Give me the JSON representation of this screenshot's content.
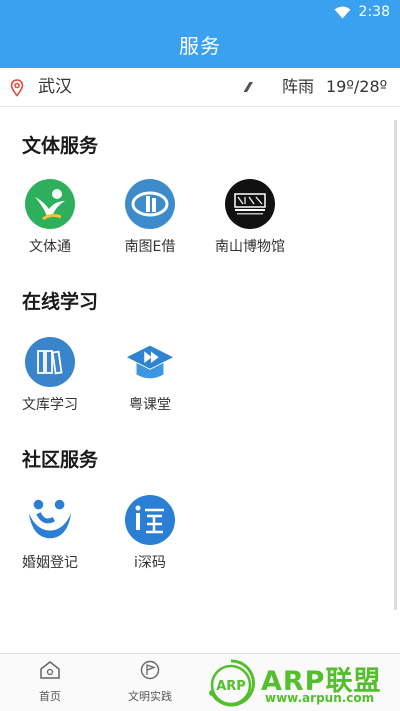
{
  "status_bar": {
    "time": "2:38",
    "wifi_icon": "wifi-icon",
    "battery_icon": "battery-icon"
  },
  "header": {
    "title": "服务",
    "background": "#3aa0f0"
  },
  "info_bar": {
    "location_icon": "location-pin-icon",
    "city": "武汉",
    "weather_icon": "rain-icon",
    "weather": "阵雨",
    "temperature": "19º/28º"
  },
  "sections": [
    {
      "title": "文体服务",
      "items": [
        {
          "label": "文体通",
          "icon": "wentitong-logo-icon",
          "color": "#2eaf5c"
        },
        {
          "label": "南图E借",
          "icon": "nantu-logo-icon",
          "color": "#3c8ccc"
        },
        {
          "label": "南山博物馆",
          "icon": "nanshan-museum-logo-icon",
          "color": "#111111"
        }
      ]
    },
    {
      "title": "在线学习",
      "items": [
        {
          "label": "文库学习",
          "icon": "books-icon",
          "color": "#3a84cc"
        },
        {
          "label": "粤课堂",
          "icon": "graduation-cap-play-icon",
          "color": "#2e84d0"
        }
      ]
    },
    {
      "title": "社区服务",
      "items": [
        {
          "label": "婚姻登记",
          "icon": "marriage-logo-icon",
          "color": "#2a7fd4"
        },
        {
          "label": "i深码",
          "icon": "ishen-logo-icon",
          "color": "#2a7fd4"
        }
      ]
    }
  ],
  "tabs": [
    {
      "label": "首页",
      "icon": "home-icon"
    },
    {
      "label": "文明实践",
      "icon": "flag-icon"
    }
  ],
  "watermark": {
    "text": "ARP联盟",
    "url": "www.arpun.com",
    "badge": "ARP",
    "color": "#53bf2c"
  }
}
